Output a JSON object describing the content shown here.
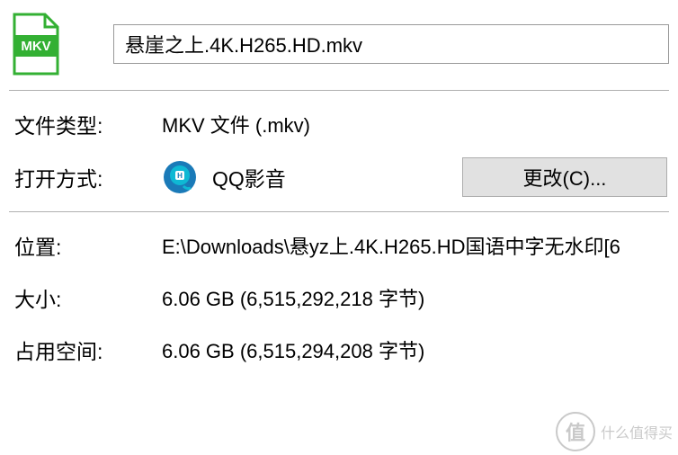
{
  "file": {
    "name": "悬崖之上.4K.H265.HD.mkv",
    "icon_label": "MKV"
  },
  "labels": {
    "file_type": "文件类型:",
    "open_with": "打开方式:",
    "location": "位置:",
    "size": "大小:",
    "size_on_disk": "占用空间:"
  },
  "values": {
    "file_type": "MKV 文件 (.mkv)",
    "open_with_app": "QQ影音",
    "location": "E:\\Downloads\\悬yz上.4K.H265.HD国语中字无水印[6",
    "size": "6.06 GB (6,515,292,218 字节)",
    "size_on_disk": "6.06 GB (6,515,294,208 字节)"
  },
  "buttons": {
    "change": "更改(C)..."
  },
  "watermark": {
    "badge": "值",
    "text": "什么值得买"
  },
  "colors": {
    "mkv_icon": "#33b033",
    "app_icon_bg": "#1a7ab8",
    "app_icon_accent": "#0fb8d4"
  }
}
